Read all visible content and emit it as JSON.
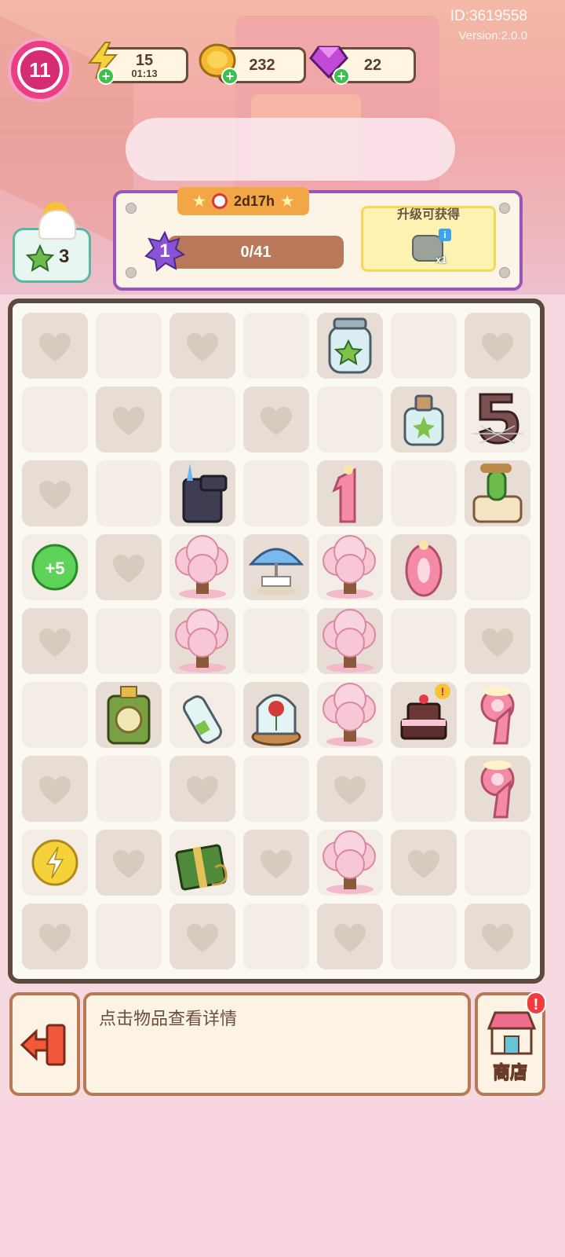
{
  "header": {
    "id_text": "ID:3619558",
    "version_text": "Version:2.0.0",
    "level": "11"
  },
  "resources": {
    "energy": {
      "value": "15",
      "timer": "01:13",
      "icon": "lightning-icon"
    },
    "coins": {
      "value": "232",
      "icon": "coin-icon"
    },
    "gems": {
      "value": "22",
      "icon": "gem-icon"
    }
  },
  "star_badge": {
    "count": "3",
    "icon": "green-star-icon"
  },
  "quest": {
    "timer": "2d17h",
    "level": "1",
    "progress_text": "0/41",
    "progress": 0,
    "reward_label": "升级可获得",
    "reward_qty": "x1",
    "reward_icon": "rock-icon"
  },
  "board": {
    "cols": 7,
    "rows": 9,
    "items": [
      {
        "r": 0,
        "c": 4,
        "type": "star-jar"
      },
      {
        "r": 1,
        "c": 5,
        "type": "small-bottle"
      },
      {
        "r": 1,
        "c": 6,
        "type": "cobweb-candle-5"
      },
      {
        "r": 2,
        "c": 2,
        "type": "dark-cylinder"
      },
      {
        "r": 2,
        "c": 4,
        "type": "candle-1"
      },
      {
        "r": 2,
        "c": 6,
        "type": "cactus-pot"
      },
      {
        "r": 3,
        "c": 0,
        "type": "plus5-orb",
        "label": "+5"
      },
      {
        "r": 3,
        "c": 2,
        "type": "sakura-tree"
      },
      {
        "r": 3,
        "c": 3,
        "type": "umbrella-table"
      },
      {
        "r": 3,
        "c": 4,
        "type": "sakura-tree"
      },
      {
        "r": 3,
        "c": 5,
        "type": "candle-0"
      },
      {
        "r": 4,
        "c": 2,
        "type": "sakura-tree"
      },
      {
        "r": 4,
        "c": 4,
        "type": "sakura-tree"
      },
      {
        "r": 5,
        "c": 1,
        "type": "green-clock-box"
      },
      {
        "r": 5,
        "c": 2,
        "type": "thin-bottle"
      },
      {
        "r": 5,
        "c": 3,
        "type": "rose-glass-dome"
      },
      {
        "r": 5,
        "c": 4,
        "type": "sakura-tree"
      },
      {
        "r": 5,
        "c": 5,
        "type": "birthday-cake"
      },
      {
        "r": 5,
        "c": 6,
        "type": "candle-9"
      },
      {
        "r": 6,
        "c": 6,
        "type": "candle-9"
      },
      {
        "r": 7,
        "c": 0,
        "type": "lightning-coin"
      },
      {
        "r": 7,
        "c": 2,
        "type": "green-gift-box"
      },
      {
        "r": 7,
        "c": 4,
        "type": "sakura-tree"
      }
    ],
    "locked_cells": [
      [
        0,
        0
      ],
      [
        0,
        2
      ],
      [
        0,
        6
      ],
      [
        1,
        1
      ],
      [
        1,
        3
      ],
      [
        2,
        0
      ],
      [
        3,
        1
      ],
      [
        4,
        0
      ],
      [
        4,
        6
      ],
      [
        6,
        0
      ],
      [
        6,
        2
      ],
      [
        6,
        4
      ],
      [
        7,
        1
      ],
      [
        7,
        3
      ],
      [
        7,
        5
      ],
      [
        8,
        0
      ],
      [
        8,
        2
      ],
      [
        8,
        4
      ],
      [
        8,
        6
      ]
    ],
    "dark_cells": [
      [
        0,
        0
      ],
      [
        0,
        2
      ],
      [
        0,
        4
      ],
      [
        0,
        6
      ],
      [
        1,
        1
      ],
      [
        1,
        3
      ],
      [
        1,
        5
      ],
      [
        2,
        0
      ],
      [
        2,
        2
      ],
      [
        2,
        4
      ],
      [
        2,
        6
      ],
      [
        3,
        1
      ],
      [
        3,
        3
      ],
      [
        3,
        5
      ],
      [
        4,
        0
      ],
      [
        4,
        2
      ],
      [
        4,
        4
      ],
      [
        4,
        6
      ],
      [
        5,
        1
      ],
      [
        5,
        3
      ],
      [
        5,
        5
      ],
      [
        6,
        0
      ],
      [
        6,
        2
      ],
      [
        6,
        4
      ],
      [
        6,
        6
      ],
      [
        7,
        1
      ],
      [
        7,
        3
      ],
      [
        7,
        5
      ],
      [
        8,
        0
      ],
      [
        8,
        2
      ],
      [
        8,
        4
      ],
      [
        8,
        6
      ]
    ]
  },
  "bottom": {
    "hint_text": "点击物品查看详情",
    "shop_label": "商店",
    "shop_alert": "!",
    "exit_icon": "exit-door-icon"
  },
  "colors": {
    "board_border": "#5c4a3e",
    "level_pink": "#ea3f83",
    "quest_border": "#9a55b8",
    "progress_bar": "#b9785a",
    "sakura": "#f7c7d6"
  }
}
